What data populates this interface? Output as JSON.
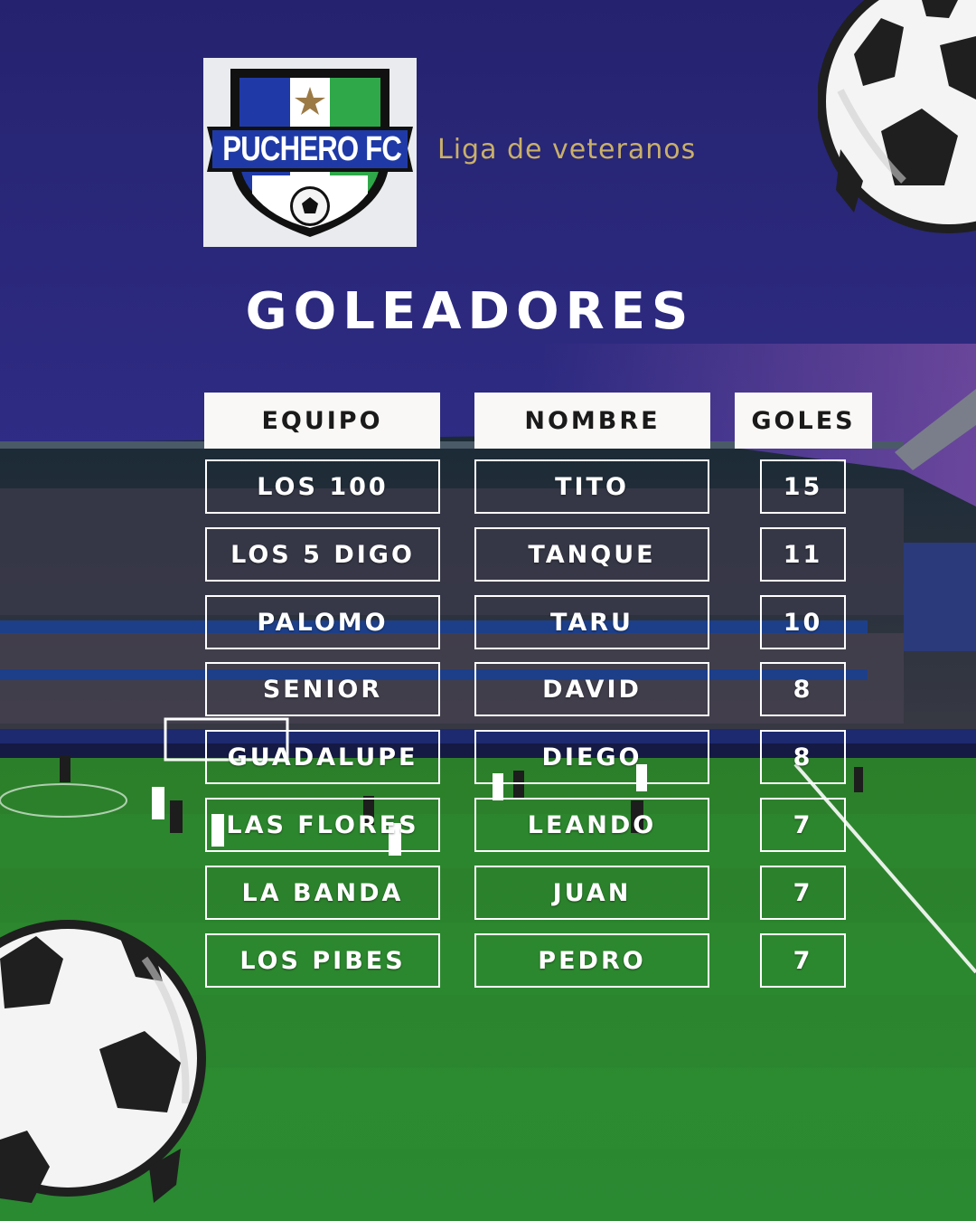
{
  "logo": {
    "text": "PUCHERO FC"
  },
  "subtitle": "Liga de veteranos",
  "title": "GOLEADORES",
  "table": {
    "headers": {
      "team": "EQUIPO",
      "name": "NOMBRE",
      "goals": "GOLES"
    },
    "rows": [
      {
        "team": "LOS 100",
        "name": "TITO",
        "goals": "15"
      },
      {
        "team": "LOS 5 DIGO",
        "name": "TANQUE",
        "goals": "11"
      },
      {
        "team": "PALOMO",
        "name": "TARU",
        "goals": "10"
      },
      {
        "team": "SENIOR",
        "name": "DAVID",
        "goals": "8"
      },
      {
        "team": "GUADALUPE",
        "name": "DIEGO",
        "goals": "8"
      },
      {
        "team": "LAS FLORES",
        "name": "LEANDO",
        "goals": "7"
      },
      {
        "team": "LA BANDA",
        "name": "JUAN",
        "goals": "7"
      },
      {
        "team": "LOS PIBES",
        "name": "PEDRO",
        "goals": "7"
      }
    ]
  },
  "colors": {
    "sky": "#2c2a82",
    "pitch": "#2f8a2c",
    "subtitle": "#c9b06a",
    "logo_blue": "#1f3aa6",
    "logo_green": "#2fa84a"
  },
  "icons": [
    "soccer-ball-icon",
    "star-icon"
  ]
}
